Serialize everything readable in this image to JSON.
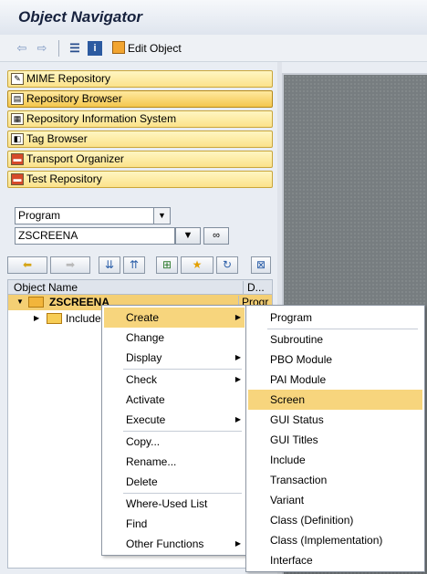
{
  "window": {
    "title": "Object Navigator"
  },
  "toolbar": {
    "back_icon": "back-arrow-icon",
    "forward_icon": "forward-arrow-icon",
    "edit_object_label": "Edit Object"
  },
  "nav_buttons": [
    {
      "label": "MIME Repository",
      "icon": "mime-icon"
    },
    {
      "label": "Repository Browser",
      "icon": "browser-icon"
    },
    {
      "label": "Repository Information System",
      "icon": "info-system-icon"
    },
    {
      "label": "Tag Browser",
      "icon": "tag-icon"
    },
    {
      "label": "Transport Organizer",
      "icon": "transport-icon"
    },
    {
      "label": "Test Repository",
      "icon": "test-icon"
    }
  ],
  "object_type": {
    "selected": "Program"
  },
  "object_name": {
    "value": "ZSCREENA"
  },
  "tree": {
    "col_object_name": "Object Name",
    "col_desc": "D...",
    "root": {
      "label": "ZSCREENA",
      "desc": "Progr"
    },
    "child": {
      "label": "Include"
    }
  },
  "context_menu": {
    "items": [
      {
        "label": "Create",
        "hl": true,
        "sub": true
      },
      {
        "label": "Change"
      },
      {
        "label": "Display",
        "sub": true
      },
      {
        "label": "Check",
        "sub": true
      },
      {
        "label": "Activate"
      },
      {
        "label": "Execute",
        "sub": true
      },
      {
        "label": "Copy..."
      },
      {
        "label": "Rename..."
      },
      {
        "label": "Delete"
      },
      {
        "label": "Where-Used List"
      },
      {
        "label": "Find"
      },
      {
        "label": "Other Functions",
        "sub": true
      }
    ]
  },
  "submenu": {
    "items": [
      {
        "label": "Program"
      },
      {
        "label": "Subroutine"
      },
      {
        "label": "PBO Module"
      },
      {
        "label": "PAI Module"
      },
      {
        "label": "Screen",
        "hl": true
      },
      {
        "label": "GUI Status"
      },
      {
        "label": "GUI Titles"
      },
      {
        "label": "Include"
      },
      {
        "label": "Transaction"
      },
      {
        "label": "Variant"
      },
      {
        "label": "Class (Definition)"
      },
      {
        "label": "Class (Implementation)"
      },
      {
        "label": "Interface"
      }
    ]
  },
  "colors": {
    "highlight": "#f7d57d",
    "nav_button": "#fbe28a"
  }
}
